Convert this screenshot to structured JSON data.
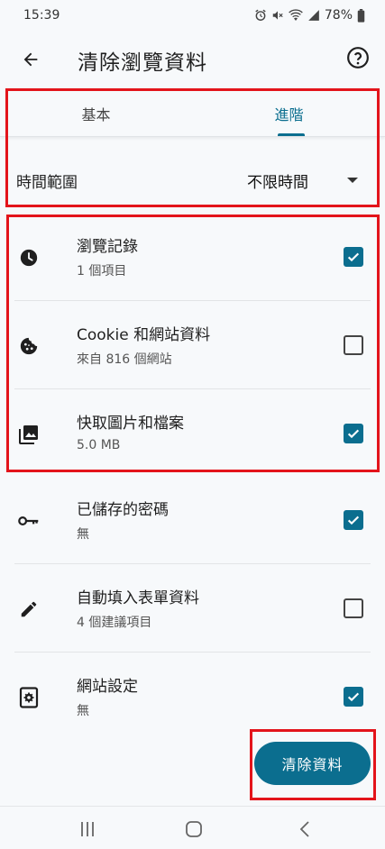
{
  "status_bar": {
    "time": "15:39",
    "battery": "78%"
  },
  "header": {
    "title": "清除瀏覽資料"
  },
  "tabs": [
    {
      "label": "基本",
      "selected": false
    },
    {
      "label": "進階",
      "selected": true
    }
  ],
  "time_range": {
    "label": "時間範圍",
    "value": "不限時間"
  },
  "items": [
    {
      "title": "瀏覽記錄",
      "subtitle": "1 個項目",
      "checked": true,
      "icon": "clock-icon"
    },
    {
      "title": "Cookie 和網站資料",
      "subtitle": "來自 816 個網站",
      "checked": false,
      "icon": "cookie-icon"
    },
    {
      "title": "快取圖片和檔案",
      "subtitle": "5.0 MB",
      "checked": true,
      "icon": "image-icon"
    },
    {
      "title": "已儲存的密碼",
      "subtitle": "無",
      "checked": true,
      "icon": "key-icon"
    },
    {
      "title": "自動填入表單資料",
      "subtitle": "4 個建議項目",
      "checked": false,
      "icon": "pencil-icon"
    },
    {
      "title": "網站設定",
      "subtitle": "無",
      "checked": true,
      "icon": "site-settings-icon"
    }
  ],
  "actions": {
    "clear_label": "清除資料"
  },
  "colors": {
    "accent": "#0b6e8f",
    "highlight": "#e3141b",
    "background": "#f7f9fb"
  }
}
